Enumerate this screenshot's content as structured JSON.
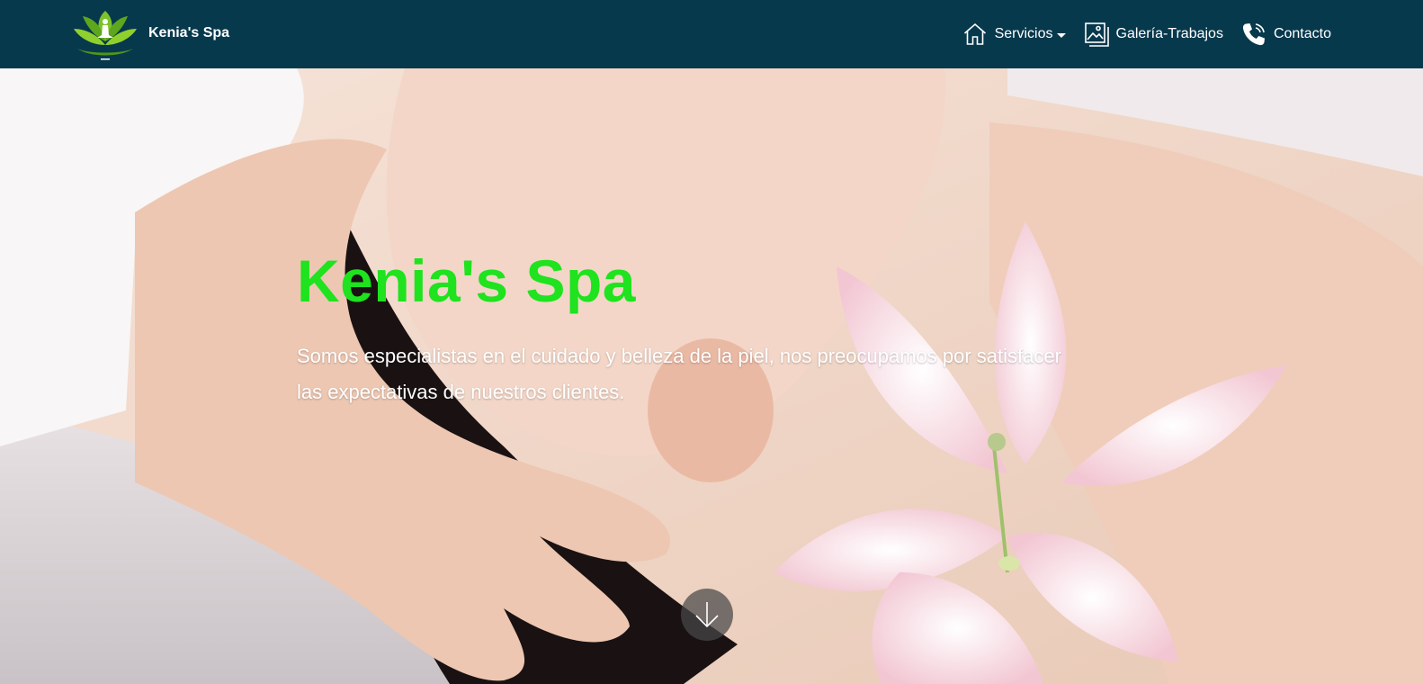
{
  "brand": {
    "name": "Kenia's Spa",
    "logo_icon": "lotus-meditation-logo"
  },
  "nav": {
    "items": [
      {
        "label": "Servicios",
        "icon": "home-icon",
        "has_dropdown": true
      },
      {
        "label": "Galería-Trabajos",
        "icon": "gallery-icon",
        "has_dropdown": false
      },
      {
        "label": "Contacto",
        "icon": "phone-icon",
        "has_dropdown": false
      }
    ]
  },
  "hero": {
    "title": "Kenia's Spa",
    "subtitle": "Somos especialistas en el cuidado y belleza de la piel, nos preocupamos por satisfacer las expectativas de nuestros clientes.",
    "scroll_icon": "arrow-down-icon"
  },
  "colors": {
    "navbar_bg": "#07394d",
    "hero_title": "#1ee31e",
    "nav_text": "#ffffff"
  }
}
